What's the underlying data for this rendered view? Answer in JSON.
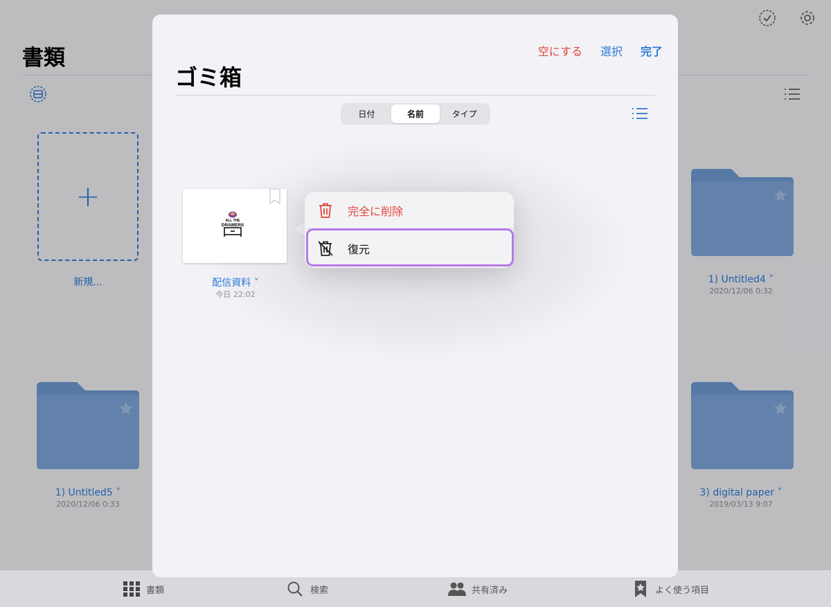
{
  "background": {
    "title": "書類",
    "new_tile_label": "新規...",
    "items": [
      {
        "name": "1) Untitled4",
        "date": "2020/12/06 0:32"
      },
      {
        "name": "1) Untitled5",
        "date": "2020/12/06 0:33"
      },
      {
        "name": "3) digital paper",
        "date": "2019/03/13 9:07"
      }
    ]
  },
  "tabbar": {
    "documents": "書類",
    "search": "検索",
    "shared": "共有済み",
    "favorites": "よく使う項目"
  },
  "trash": {
    "title": "ゴミ箱",
    "actions": {
      "empty": "空にする",
      "select": "選択",
      "done": "完了"
    },
    "sort": {
      "options": [
        "日付",
        "名前",
        "タイプ"
      ],
      "selected": "名前"
    },
    "document": {
      "name": "配信資料",
      "date": "今日 22:02",
      "logo_text": [
        "ALL THE",
        "DRAWERS"
      ]
    }
  },
  "context_menu": {
    "delete_label": "完全に削除",
    "restore_label": "復元"
  },
  "colors": {
    "accent": "#2f7ad6",
    "destructive": "#e0463c",
    "focus": "#b57ae6"
  }
}
